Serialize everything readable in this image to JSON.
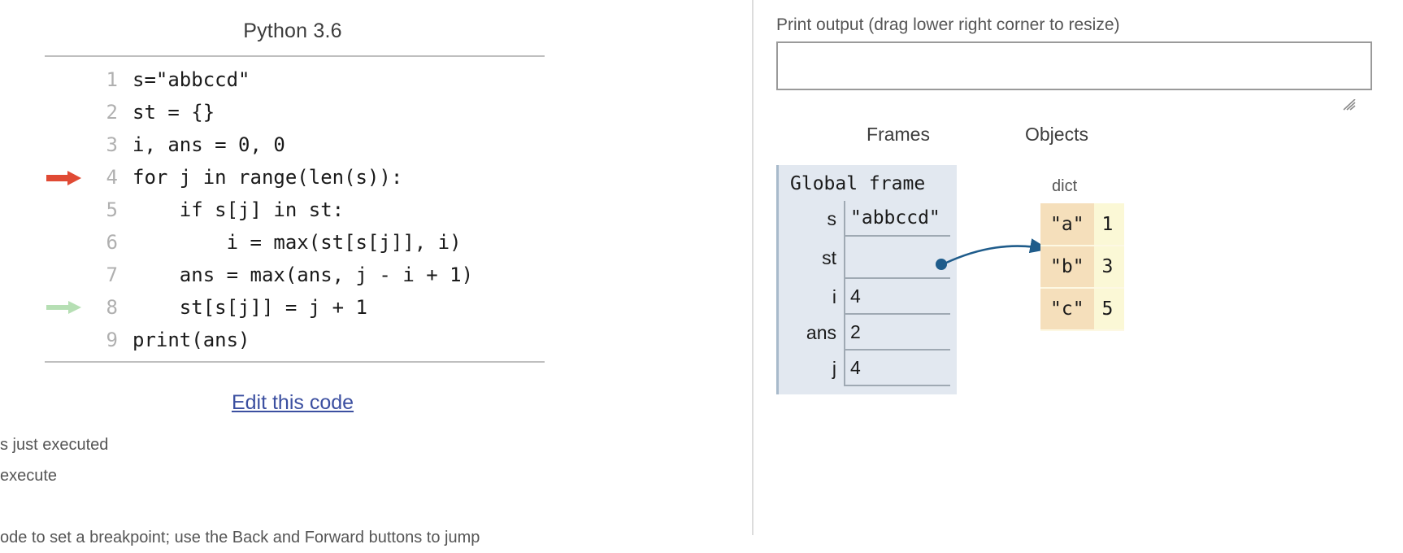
{
  "left": {
    "title": "Python 3.6",
    "code": {
      "lines": [
        {
          "no": "1",
          "text": "s=\"abbccd\"",
          "marker": "none"
        },
        {
          "no": "2",
          "text": "st = {}",
          "marker": "none"
        },
        {
          "no": "3",
          "text": "i, ans = 0, 0",
          "marker": "none"
        },
        {
          "no": "4",
          "text": "for j in range(len(s)):",
          "marker": "red-arrow-icon"
        },
        {
          "no": "5",
          "text": "    if s[j] in st:",
          "marker": "none"
        },
        {
          "no": "6",
          "text": "        i = max(st[s[j]], i)",
          "marker": "none"
        },
        {
          "no": "7",
          "text": "    ans = max(ans, j - i + 1)",
          "marker": "none"
        },
        {
          "no": "8",
          "text": "    st[s[j]] = j + 1",
          "marker": "green-arrow-icon"
        },
        {
          "no": "9",
          "text": "print(ans)",
          "marker": "none"
        }
      ]
    },
    "edit_link": "Edit this code",
    "legend": {
      "just_executed": "s just executed",
      "next_to_execute": "execute",
      "hint": "ode to set a breakpoint; use the Back and Forward buttons to jump"
    }
  },
  "right": {
    "print_output": {
      "label": "Print output (drag lower right corner to resize)",
      "value": "",
      "resize_handle": "resize-grip-icon"
    },
    "frames_heading": "Frames",
    "objects_heading": "Objects",
    "frame": {
      "title": "Global frame",
      "variables": [
        {
          "name": "s",
          "value": "\"abbccd\"",
          "kind": "mono"
        },
        {
          "name": "st",
          "value": "",
          "kind": "pointer"
        },
        {
          "name": "i",
          "value": "4",
          "kind": "plain"
        },
        {
          "name": "ans",
          "value": "2",
          "kind": "plain"
        },
        {
          "name": "j",
          "value": "4",
          "kind": "plain"
        }
      ]
    },
    "object": {
      "type_label": "dict",
      "entries": [
        {
          "key": "\"a\"",
          "value": "1"
        },
        {
          "key": "\"b\"",
          "value": "3"
        },
        {
          "key": "\"c\"",
          "value": "5"
        }
      ]
    }
  },
  "colors": {
    "frame_bg": "#e2e8f0",
    "dict_key_bg": "#f5dfbb",
    "dict_val_bg": "#fbf8d6",
    "pointer_arrow": "#1f5c8b",
    "executed_arrow": "#e04a34",
    "next_arrow": "#b6dfb4",
    "link": "#3b4fa0"
  }
}
